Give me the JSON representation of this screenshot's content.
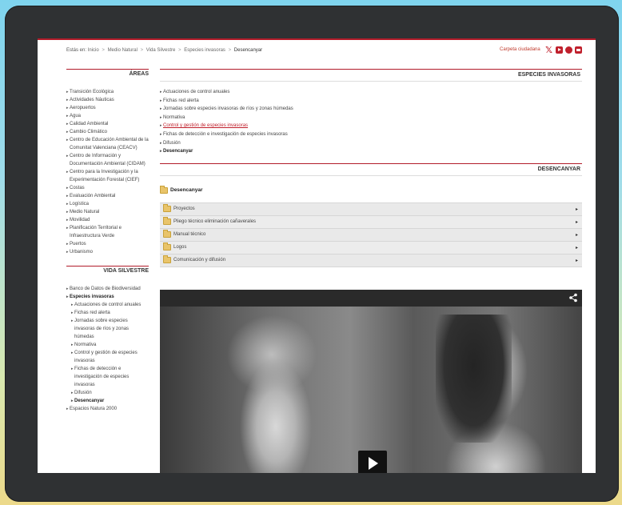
{
  "breadcrumb": {
    "prefix": "Estás en:",
    "items": [
      "Inicio",
      "Medio Natural",
      "Vida Silvestre",
      "Especies invasoras",
      "Desencanyar"
    ],
    "separator": ">"
  },
  "header": {
    "carpeta_label": "Carpeta ciudadana",
    "social_icons": [
      "x-icon",
      "youtube-icon",
      "facebook-icon",
      "flickr-icon"
    ]
  },
  "sidebar": {
    "areas_title": "ÁREAS",
    "areas": [
      "Transición Ecológica",
      "Actividades Náuticas",
      "Aeropuertos",
      "Agua",
      "Calidad Ambiental",
      "Cambio Climático",
      "Centro de Educación Ambiental de la Comunitat Valenciana (CEACV)",
      "Centro de Información y Documentación Ambiental (CIDAM)",
      "Centro para la Investigación y la Experimentación Forestal (CIEF)",
      "Costas",
      "Evaluación Ambiental",
      "Logística",
      "Medio Natural",
      "Movilidad",
      "Planificación Territorial e Infraestructura Verde",
      "Puertos",
      "Urbanismo"
    ],
    "vida_title": "VIDA SILVESTRE",
    "vida_items": [
      {
        "label": "Banco de Datos de Biodiversidad",
        "level": 0,
        "bold": false
      },
      {
        "label": "Especies invasoras",
        "level": 0,
        "bold": true
      },
      {
        "label": "Actuaciones de control anuales",
        "level": 1,
        "bold": false
      },
      {
        "label": "Fichas red alerta",
        "level": 1,
        "bold": false
      },
      {
        "label": "Jornadas sobre especies invasoras de ríos y zonas húmedas",
        "level": 1,
        "bold": false
      },
      {
        "label": "Normativa",
        "level": 1,
        "bold": false
      },
      {
        "label": "Control y gestión de especies invasoras",
        "level": 1,
        "bold": false
      },
      {
        "label": "Fichas de detección e investigación de especies invasoras",
        "level": 1,
        "bold": false
      },
      {
        "label": "Difusión",
        "level": 1,
        "bold": false
      },
      {
        "label": "Desencanyar",
        "level": 1,
        "bold": true
      },
      {
        "label": "Espacios Natura 2000",
        "level": 0,
        "bold": false
      }
    ]
  },
  "main": {
    "section_title": "ESPECIES INVASORAS",
    "links": [
      {
        "label": "Actuaciones de control anuales",
        "style": "normal"
      },
      {
        "label": "Fichas red alerta",
        "style": "normal"
      },
      {
        "label": "Jornadas sobre especies invasoras de ríos y zonas húmedas",
        "style": "normal"
      },
      {
        "label": "Normativa",
        "style": "normal"
      },
      {
        "label": "Control y gestión de especies invasoras",
        "style": "link"
      },
      {
        "label": "Fichas de detección e investigación de especies invasoras",
        "style": "normal"
      },
      {
        "label": "Difusión",
        "style": "normal"
      },
      {
        "label": "Desencanyar",
        "style": "bold"
      }
    ],
    "subsection_title": "DESENCANYAR",
    "folder_title": "Desencanyar",
    "accordion": [
      "Proyectos",
      "Pliego técnico eliminación cañaverales",
      "Manual técnico",
      "Logos",
      "Comunicación y difusión"
    ]
  }
}
